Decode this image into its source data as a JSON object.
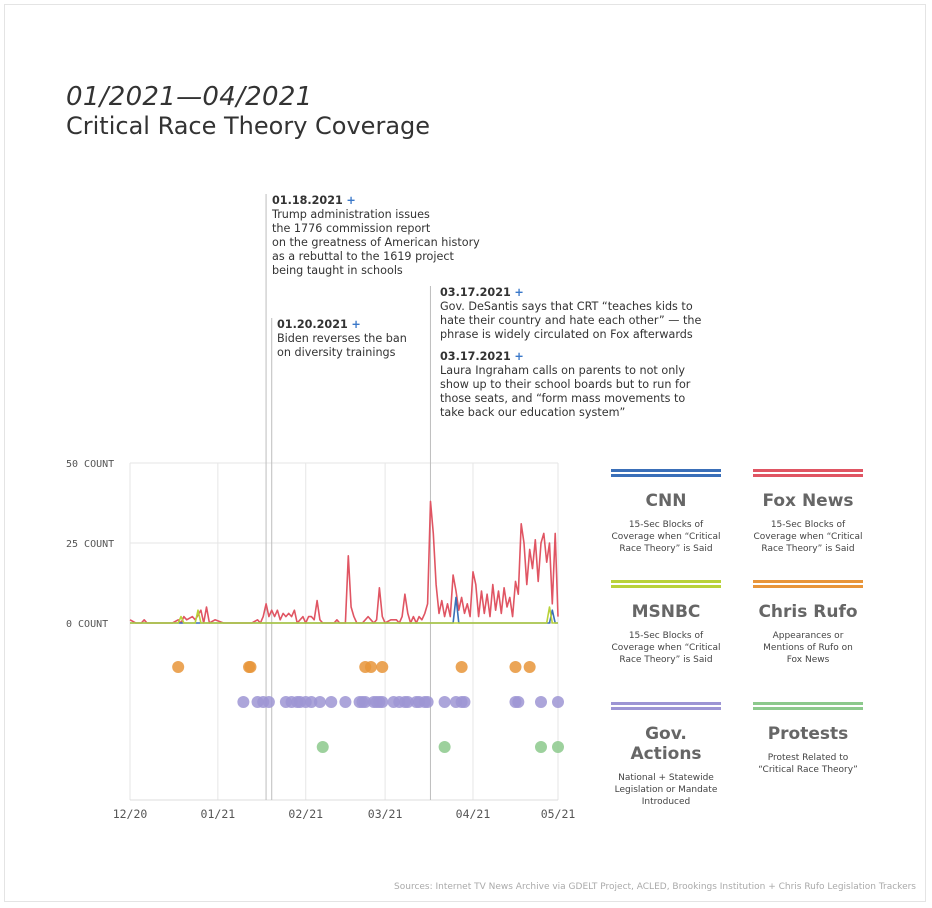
{
  "header": {
    "date_range": "01/2021—04/2021",
    "title": "Critical Race Theory Coverage"
  },
  "annotations": [
    {
      "date": "01.18.2021",
      "plus": "+",
      "text": "Trump administration issues\nthe 1776 commission report\non the greatness of American history\nas a rebuttal to the 1619 project\nbeing taught in schools"
    },
    {
      "date": "01.20.2021",
      "plus": "+",
      "text": "Biden reverses the ban\non diversity trainings"
    },
    {
      "date": "03.17.2021",
      "plus": "+",
      "text": "Gov. DeSantis says that CRT “teaches kids to\nhate their country and hate each other” — the\nphrase is widely circulated on Fox afterwards"
    },
    {
      "date": "03.17.2021",
      "plus": "+",
      "text": "Laura Ingraham calls on parents to not only\nshow up to their school boards but to run for\nthose seats, and “form mass movements to\ntake back our education system”"
    }
  ],
  "legend": [
    {
      "name": "CNN",
      "color": "#3a6fb8",
      "desc": "15-Sec Blocks of\nCoverage when “Critical\nRace Theory” is Said"
    },
    {
      "name": "Fox News",
      "color": "#e05563",
      "desc": "15-Sec Blocks of\nCoverage when “Critical\nRace Theory” is Said"
    },
    {
      "name": "MSNBC",
      "color": "#b9d23a",
      "desc": "15-Sec Blocks of\nCoverage when “Critical\nRace Theory” is Said"
    },
    {
      "name": "Chris Rufo",
      "color": "#e8953a",
      "desc": "Appearances or\nMentions of Rufo on\nFox News"
    },
    {
      "name": "Gov. Actions",
      "color": "#9d95d4",
      "desc": "National + Statewide\nLegislation or Mandate\nIntroduced"
    },
    {
      "name": "Protests",
      "color": "#8cc98c",
      "desc": "Protest Related to\n“Critical Race Theory”"
    }
  ],
  "source": "Sources: Internet TV News Archive via GDELT Project, ACLED, Brookings Institution + Chris Rufo Legislation Trackers",
  "chart_data": {
    "type": "line",
    "x_unit": "days since 2020-12-01",
    "xlim": [
      0,
      151
    ],
    "ylim": [
      0,
      50
    ],
    "y_ticks": [
      {
        "value": 0,
        "label": "0 COUNT"
      },
      {
        "value": 25,
        "label": "25 COUNT"
      },
      {
        "value": 50,
        "label": "50 COUNT"
      }
    ],
    "x_ticks": [
      {
        "value": 0,
        "label": "12/20"
      },
      {
        "value": 31,
        "label": "01/21"
      },
      {
        "value": 62,
        "label": "02/21"
      },
      {
        "value": 90,
        "label": "03/21"
      },
      {
        "value": 121,
        "label": "04/21"
      },
      {
        "value": 151,
        "label": "05/21"
      }
    ],
    "event_lines": [
      48,
      50,
      106
    ],
    "series": [
      {
        "name": "Fox News",
        "color": "#e05563",
        "points": [
          [
            0,
            1
          ],
          [
            2,
            0
          ],
          [
            4,
            0
          ],
          [
            5,
            1
          ],
          [
            6,
            0
          ],
          [
            15,
            0
          ],
          [
            17,
            1
          ],
          [
            18,
            0
          ],
          [
            19,
            2
          ],
          [
            20,
            1
          ],
          [
            22,
            2
          ],
          [
            23,
            1
          ],
          [
            25,
            4
          ],
          [
            26,
            0
          ],
          [
            27,
            5
          ],
          [
            28,
            0
          ],
          [
            30,
            1
          ],
          [
            33,
            0
          ],
          [
            35,
            0
          ],
          [
            43,
            0
          ],
          [
            45,
            1
          ],
          [
            46,
            0
          ],
          [
            47,
            2
          ],
          [
            48,
            6
          ],
          [
            49,
            2
          ],
          [
            50,
            4
          ],
          [
            51,
            2
          ],
          [
            52,
            4
          ],
          [
            53,
            1
          ],
          [
            54,
            3
          ],
          [
            55,
            2
          ],
          [
            56,
            3
          ],
          [
            57,
            2
          ],
          [
            58,
            4
          ],
          [
            59,
            0
          ],
          [
            60,
            1
          ],
          [
            61,
            2
          ],
          [
            62,
            0
          ],
          [
            63,
            2
          ],
          [
            64,
            2
          ],
          [
            65,
            1
          ],
          [
            66,
            7
          ],
          [
            67,
            1
          ],
          [
            68,
            0
          ],
          [
            72,
            0
          ],
          [
            73,
            1
          ],
          [
            74,
            0
          ],
          [
            76,
            0
          ],
          [
            77,
            21
          ],
          [
            78,
            5
          ],
          [
            79,
            2
          ],
          [
            80,
            0
          ],
          [
            82,
            0
          ],
          [
            83,
            1
          ],
          [
            84,
            2
          ],
          [
            85,
            1
          ],
          [
            86,
            0
          ],
          [
            87,
            1
          ],
          [
            88,
            11
          ],
          [
            89,
            2
          ],
          [
            90,
            0
          ],
          [
            92,
            1
          ],
          [
            93,
            1
          ],
          [
            94,
            1
          ],
          [
            95,
            0
          ],
          [
            96,
            2
          ],
          [
            97,
            9
          ],
          [
            98,
            3
          ],
          [
            99,
            0
          ],
          [
            100,
            2
          ],
          [
            101,
            0
          ],
          [
            102,
            2
          ],
          [
            103,
            1
          ],
          [
            104,
            3
          ],
          [
            105,
            6
          ],
          [
            106,
            38
          ],
          [
            107,
            28
          ],
          [
            108,
            12
          ],
          [
            109,
            3
          ],
          [
            110,
            7
          ],
          [
            111,
            2
          ],
          [
            112,
            6
          ],
          [
            113,
            2
          ],
          [
            114,
            15
          ],
          [
            115,
            10
          ],
          [
            116,
            4
          ],
          [
            117,
            8
          ],
          [
            118,
            3
          ],
          [
            119,
            6
          ],
          [
            120,
            2
          ],
          [
            121,
            16
          ],
          [
            122,
            12
          ],
          [
            123,
            2
          ],
          [
            124,
            10
          ],
          [
            125,
            3
          ],
          [
            126,
            9
          ],
          [
            127,
            2
          ],
          [
            128,
            12
          ],
          [
            129,
            4
          ],
          [
            130,
            10
          ],
          [
            131,
            3
          ],
          [
            132,
            11
          ],
          [
            133,
            5
          ],
          [
            134,
            8
          ],
          [
            135,
            2
          ],
          [
            136,
            13
          ],
          [
            137,
            9
          ],
          [
            138,
            31
          ],
          [
            139,
            25
          ],
          [
            140,
            12
          ],
          [
            141,
            23
          ],
          [
            142,
            17
          ],
          [
            143,
            26
          ],
          [
            144,
            13
          ],
          [
            145,
            25
          ],
          [
            146,
            28
          ],
          [
            147,
            19
          ],
          [
            148,
            25
          ],
          [
            149,
            6
          ],
          [
            150,
            28
          ],
          [
            151,
            2
          ]
        ]
      },
      {
        "name": "CNN",
        "color": "#3a6fb8",
        "points": [
          [
            0,
            0
          ],
          [
            114,
            0
          ],
          [
            115,
            8
          ],
          [
            116,
            0
          ],
          [
            148,
            0
          ],
          [
            149,
            4
          ],
          [
            150,
            0
          ],
          [
            151,
            0
          ]
        ]
      },
      {
        "name": "MSNBC",
        "color": "#b9d23a",
        "points": [
          [
            0,
            0
          ],
          [
            17,
            0
          ],
          [
            18,
            2
          ],
          [
            19,
            0
          ],
          [
            23,
            0
          ],
          [
            24,
            4
          ],
          [
            25,
            0
          ],
          [
            147,
            0
          ],
          [
            148,
            5
          ],
          [
            149,
            0
          ],
          [
            151,
            0
          ]
        ]
      }
    ],
    "dot_rows": [
      {
        "name": "Chris Rufo",
        "color": "#e8953a",
        "x": [
          17,
          42,
          42.5,
          83,
          85,
          89,
          117,
          136,
          141
        ]
      },
      {
        "name": "Gov. Actions",
        "color": "#9d95d4",
        "x": [
          40,
          45,
          47,
          49,
          55,
          57,
          59,
          60,
          62,
          64,
          67,
          71,
          76,
          81,
          82,
          83,
          86,
          87,
          88,
          89,
          93,
          95,
          97,
          98,
          101,
          102,
          104,
          105,
          111,
          115,
          117,
          118,
          136,
          137,
          145,
          151
        ]
      },
      {
        "name": "Protests",
        "color": "#8cc98c",
        "x": [
          68,
          111,
          145,
          151
        ]
      }
    ]
  }
}
